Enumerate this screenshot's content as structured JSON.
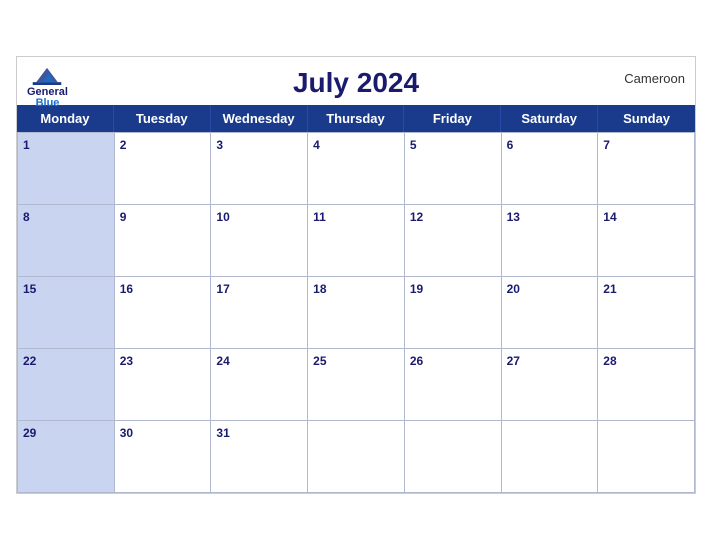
{
  "header": {
    "logo_general": "General",
    "logo_blue": "Blue",
    "title": "July 2024",
    "country": "Cameroon"
  },
  "dayHeaders": [
    "Monday",
    "Tuesday",
    "Wednesday",
    "Thursday",
    "Friday",
    "Saturday",
    "Sunday"
  ],
  "weeks": [
    [
      1,
      2,
      3,
      4,
      5,
      6,
      7
    ],
    [
      8,
      9,
      10,
      11,
      12,
      13,
      14
    ],
    [
      15,
      16,
      17,
      18,
      19,
      20,
      21
    ],
    [
      22,
      23,
      24,
      25,
      26,
      27,
      28
    ],
    [
      29,
      30,
      31,
      null,
      null,
      null,
      null
    ]
  ]
}
